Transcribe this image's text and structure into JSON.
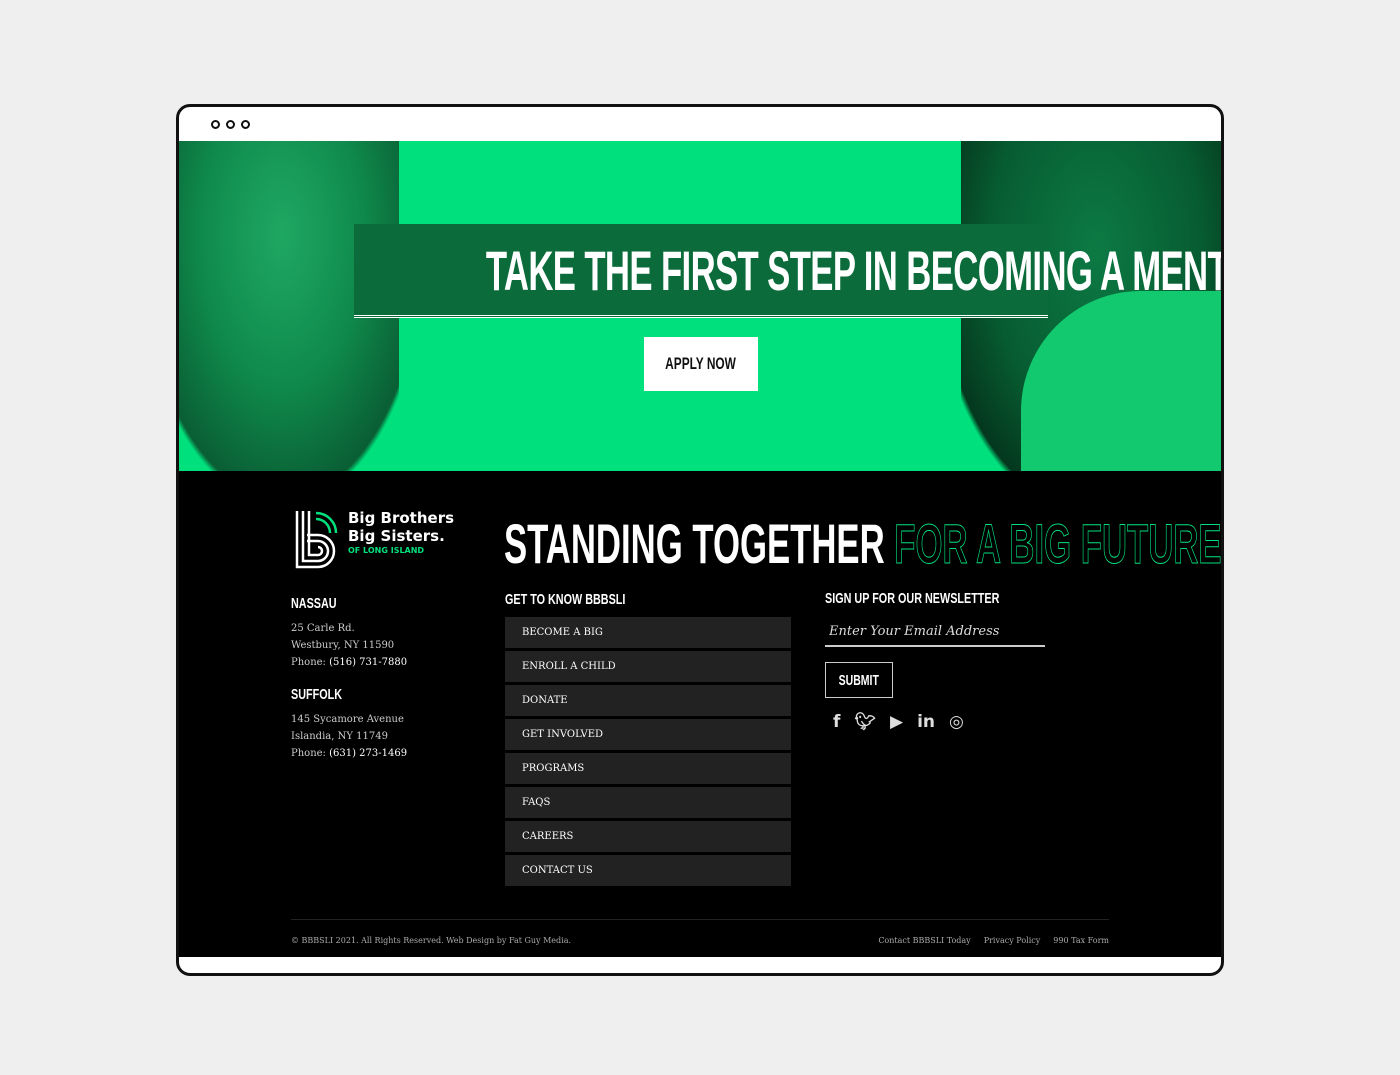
{
  "hero": {
    "title": "TAKE THE FIRST STEP IN BECOMING A MENTOR",
    "apply_label": "APPLY NOW"
  },
  "brand": {
    "line1": "Big Brothers",
    "line2": "Big Sisters.",
    "line3": "OF LONG ISLAND",
    "accent": "#00e07c"
  },
  "headline": {
    "white": "STANDING TOGETHER",
    "green": "FOR A BIG FUTURE"
  },
  "locations": [
    {
      "name": "NASSAU",
      "street": "25 Carle Rd.",
      "city": "Westbury, NY 11590",
      "phone_label": "Phone:",
      "phone": "(516) 731-7880"
    },
    {
      "name": "SUFFOLK",
      "street": "145 Sycamore Avenue",
      "city": "Islandia, NY 11749",
      "phone_label": "Phone:",
      "phone": "(631) 273-1469"
    }
  ],
  "nav": {
    "title": "GET TO KNOW BBBSLI",
    "items": [
      "BECOME A BIG",
      "ENROLL A CHILD",
      "DONATE",
      "GET INVOLVED",
      "PROGRAMS",
      "FAQS",
      "CAREERS",
      "CONTACT US"
    ]
  },
  "newsletter": {
    "title": "SIGN UP FOR OUR NEWSLETTER",
    "placeholder": "Enter Your Email Address",
    "submit": "SUBMIT"
  },
  "social": [
    "facebook-icon",
    "twitter-icon",
    "youtube-icon",
    "linkedin-icon",
    "instagram-icon"
  ],
  "bottom": {
    "copyright": "© BBBSLI 2021. All Rights Reserved. Web Design by Fat Guy Media.",
    "links": [
      "Contact BBBSLI Today",
      "Privacy Policy",
      "990 Tax Form"
    ]
  }
}
